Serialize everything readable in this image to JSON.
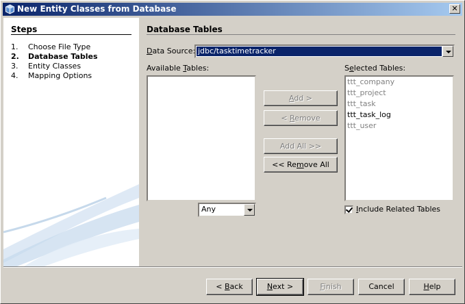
{
  "window": {
    "title": "New Entity Classes from Database",
    "close_glyph": "✕"
  },
  "steps": {
    "title": "Steps",
    "items": [
      {
        "num": "1.",
        "label": "Choose File Type"
      },
      {
        "num": "2.",
        "label": "Database Tables"
      },
      {
        "num": "3.",
        "label": "Entity Classes"
      },
      {
        "num": "4.",
        "label": "Mapping Options"
      }
    ],
    "current_index": 1
  },
  "panel": {
    "title": "Database Tables",
    "data_source": {
      "label_mnemonic": "D",
      "label_rest": "ata Source:",
      "value": "jdbc/tasktimetracker"
    },
    "available": {
      "label_pre": "Available ",
      "label_mnemonic": "T",
      "label_post": "ables:",
      "items": [],
      "filter": "Any"
    },
    "selected": {
      "label_pre": "S",
      "label_mnemonic": "e",
      "label_post": "lected Tables:",
      "items": [
        {
          "name": "ttt_company",
          "enabled": false
        },
        {
          "name": "ttt_project",
          "enabled": false
        },
        {
          "name": "ttt_task",
          "enabled": false
        },
        {
          "name": "ttt_task_log",
          "enabled": true
        },
        {
          "name": "ttt_user",
          "enabled": false
        }
      ]
    },
    "buttons": {
      "add": {
        "mnemonic": "A",
        "rest": "dd >"
      },
      "remove": {
        "pre": "< ",
        "mnemonic": "R",
        "rest": "emove"
      },
      "add_all": "Add All >>",
      "remove_all": {
        "pre": "<< Re",
        "mnemonic": "m",
        "rest": "ove All"
      }
    },
    "include_related": {
      "pre": "",
      "mnemonic": "I",
      "rest": "nclude Related Tables",
      "checked": true
    }
  },
  "footer": {
    "back": {
      "pre": "< ",
      "mnemonic": "B",
      "rest": "ack"
    },
    "next": {
      "mnemonic": "N",
      "rest": "ext >"
    },
    "finish": {
      "mnemonic": "F",
      "rest": "inish"
    },
    "cancel": "Cancel",
    "help": {
      "mnemonic": "H",
      "rest": "elp"
    }
  },
  "colors": {
    "title_start": "#0a246a",
    "title_end": "#a6caf0",
    "selection": "#0a246a",
    "face": "#d4d0c8"
  }
}
